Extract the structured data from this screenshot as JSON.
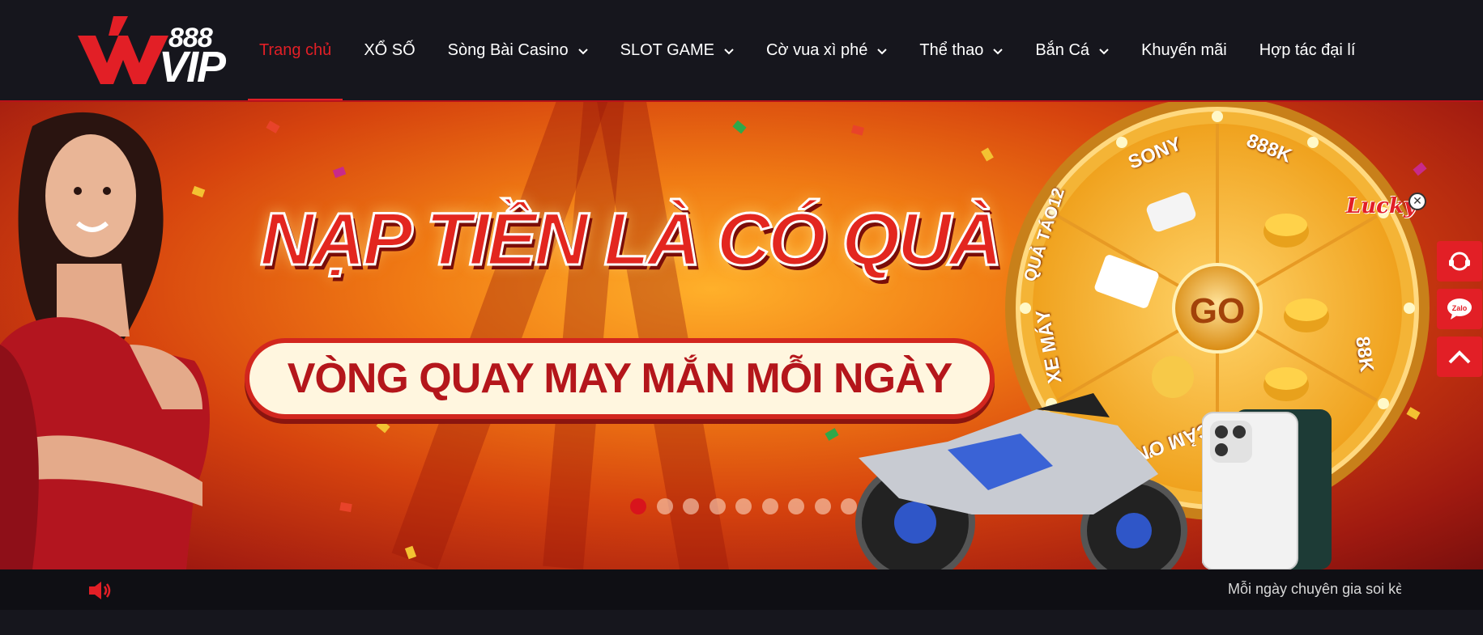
{
  "logo": {
    "number": "888",
    "text": "VIP"
  },
  "nav": {
    "items": [
      {
        "label": "Trang chủ",
        "active": true,
        "dropdown": false
      },
      {
        "label": "XỔ SỐ",
        "active": false,
        "dropdown": false
      },
      {
        "label": "Sòng Bài Casino",
        "active": false,
        "dropdown": true
      },
      {
        "label": "SLOT GAME",
        "active": false,
        "dropdown": true
      },
      {
        "label": "Cờ vua xì phé",
        "active": false,
        "dropdown": true
      },
      {
        "label": "Thể thao",
        "active": false,
        "dropdown": true
      },
      {
        "label": "Bắn Cá",
        "active": false,
        "dropdown": true
      },
      {
        "label": "Khuyến mãi",
        "active": false,
        "dropdown": false
      },
      {
        "label": "Hợp tác đại lí",
        "active": false,
        "dropdown": false
      }
    ]
  },
  "banner": {
    "headline": "NẠP TIỀN LÀ CÓ QUÀ",
    "subheadline": "VÒNG QUAY MAY MẮN MỖI NGÀY",
    "wheel": {
      "center": "GO",
      "labels": [
        "SONY",
        "888K",
        "QUẢ TÁO12",
        "88K",
        "XE MÁY",
        "CẢM ƠN"
      ]
    },
    "lucky_badge": "Lucky",
    "slides_count": 9,
    "active_slide": 1
  },
  "side_buttons": {
    "zalo_label": "Zalo"
  },
  "ticker": {
    "text": "Mỗi ngày chuyên gia soi kèo"
  },
  "colors": {
    "accent": "#e21f26",
    "header_bg": "#16161d",
    "banner_orange": "#f07a14"
  }
}
